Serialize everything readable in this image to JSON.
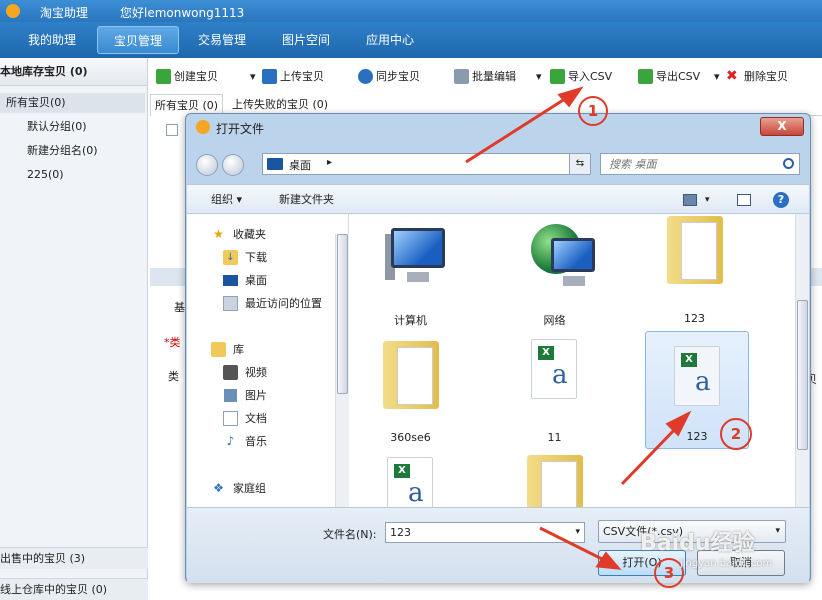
{
  "app": {
    "title": "淘宝助理",
    "greeting": "您好lemonwong1113"
  },
  "nav": {
    "tabs": [
      {
        "label": "我的助理"
      },
      {
        "label": "宝贝管理"
      },
      {
        "label": "交易管理"
      },
      {
        "label": "图片空间"
      },
      {
        "label": "应用中心"
      }
    ]
  },
  "sidebar": {
    "header": "本地库存宝贝 (0)",
    "items": [
      {
        "label": "所有宝贝(0)"
      },
      {
        "label": "默认分组(0)"
      },
      {
        "label": "新建分组名(0)"
      },
      {
        "label": "225(0)"
      }
    ],
    "bottom": [
      {
        "label": "出售中的宝贝 (3)"
      },
      {
        "label": "线上仓库中的宝贝 (0)"
      }
    ]
  },
  "toolbar": {
    "create": "创建宝贝",
    "upload": "上传宝贝",
    "sync": "同步宝贝",
    "batch_edit": "批量编辑",
    "import_csv": "导入CSV",
    "export_csv": "导出CSV",
    "delete": "删除宝贝"
  },
  "subtabs": {
    "all": "所有宝贝 (0)",
    "failed": "上传失败的宝贝 (0)"
  },
  "background_fragments": {
    "basic": "基",
    "category_required": "*类",
    "category": "类",
    "partial_right": "贝"
  },
  "dialog": {
    "title": "打开文件",
    "close_label": "X",
    "address": "桌面",
    "search_placeholder": "搜索 桌面",
    "commands": {
      "organize": "组织 ▾",
      "new_folder": "新建文件夹"
    },
    "nav_items": [
      {
        "label": "收藏夹",
        "icon": "star-icon"
      },
      {
        "label": "下载",
        "icon": "download-folder-icon"
      },
      {
        "label": "桌面",
        "icon": "desktop-icon"
      },
      {
        "label": "最近访问的位置",
        "icon": "recent-places-icon"
      },
      {
        "label": "库",
        "icon": "library-icon"
      },
      {
        "label": "视频",
        "icon": "video-icon"
      },
      {
        "label": "图片",
        "icon": "picture-icon"
      },
      {
        "label": "文档",
        "icon": "document-icon"
      },
      {
        "label": "音乐",
        "icon": "music-icon"
      },
      {
        "label": "家庭组",
        "icon": "homegroup-icon"
      }
    ],
    "files": [
      {
        "label": "计算机",
        "icon": "computer-icon"
      },
      {
        "label": "网络",
        "icon": "network-icon"
      },
      {
        "label": "123",
        "icon": "folder-icon"
      },
      {
        "label": "360se6",
        "icon": "folder-icon"
      },
      {
        "label": "11",
        "icon": "csv-file-icon"
      },
      {
        "label": "123",
        "icon": "csv-file-icon",
        "selected": true
      },
      {
        "label": "",
        "icon": "csv-file-icon"
      },
      {
        "label": "",
        "icon": "folder-icon"
      }
    ],
    "filename_label": "文件名(N):",
    "filename_value": "123",
    "filter": "CSV文件(*.csv)",
    "open_button": "打开(O)",
    "cancel_button": "取消"
  },
  "annotations": {
    "markers": [
      "1",
      "2",
      "3"
    ],
    "color": "#e03a2a"
  },
  "watermark": {
    "brand": "Baidu经验",
    "url": "jingyan.baidu.com"
  }
}
